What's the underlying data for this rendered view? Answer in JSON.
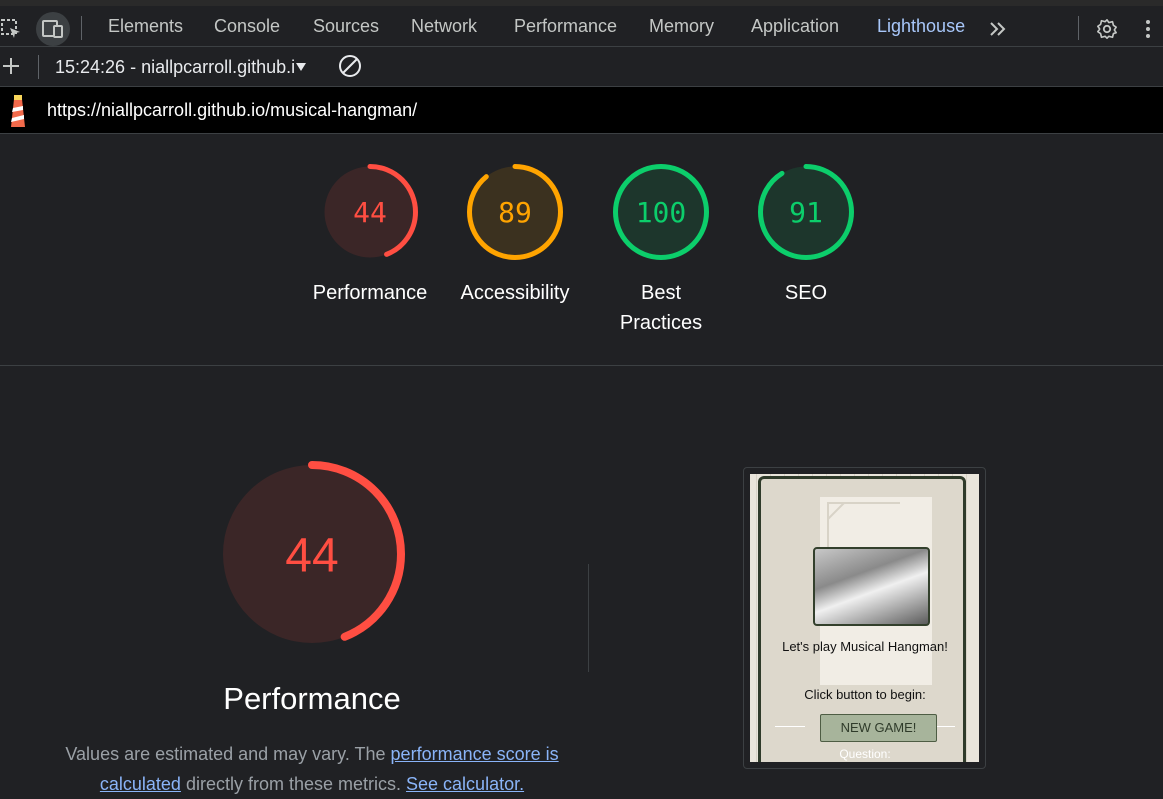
{
  "tabs": {
    "items": [
      "Elements",
      "Console",
      "Sources",
      "Network",
      "Performance",
      "Memory",
      "Application",
      "Lighthouse"
    ],
    "active": "Lighthouse"
  },
  "toolbar": {
    "report_selector": "15:24:26 - niallpcarroll.github.io"
  },
  "url": "https://niallpcarroll.github.io/musical-hangman/",
  "scores": [
    {
      "label": "Performance",
      "value": 44,
      "color": "#ff4e42"
    },
    {
      "label": "Accessibility",
      "value": 89,
      "color": "#ffa400"
    },
    {
      "label": "Best Practices",
      "value": 100,
      "color": "#0cce6b"
    },
    {
      "label": "SEO",
      "value": 91,
      "color": "#0cce6b"
    }
  ],
  "performance_section": {
    "score": 44,
    "title": "Performance",
    "desc_prefix": "Values are estimated and may vary. The ",
    "link1": "performance score is calculated",
    "desc_mid": " directly from these metrics. ",
    "link2": "See calculator."
  },
  "screenshot": {
    "line1": "Let's play Musical Hangman!",
    "line2": "Click button to begin:",
    "button": "NEW GAME!",
    "question": "Question:"
  }
}
